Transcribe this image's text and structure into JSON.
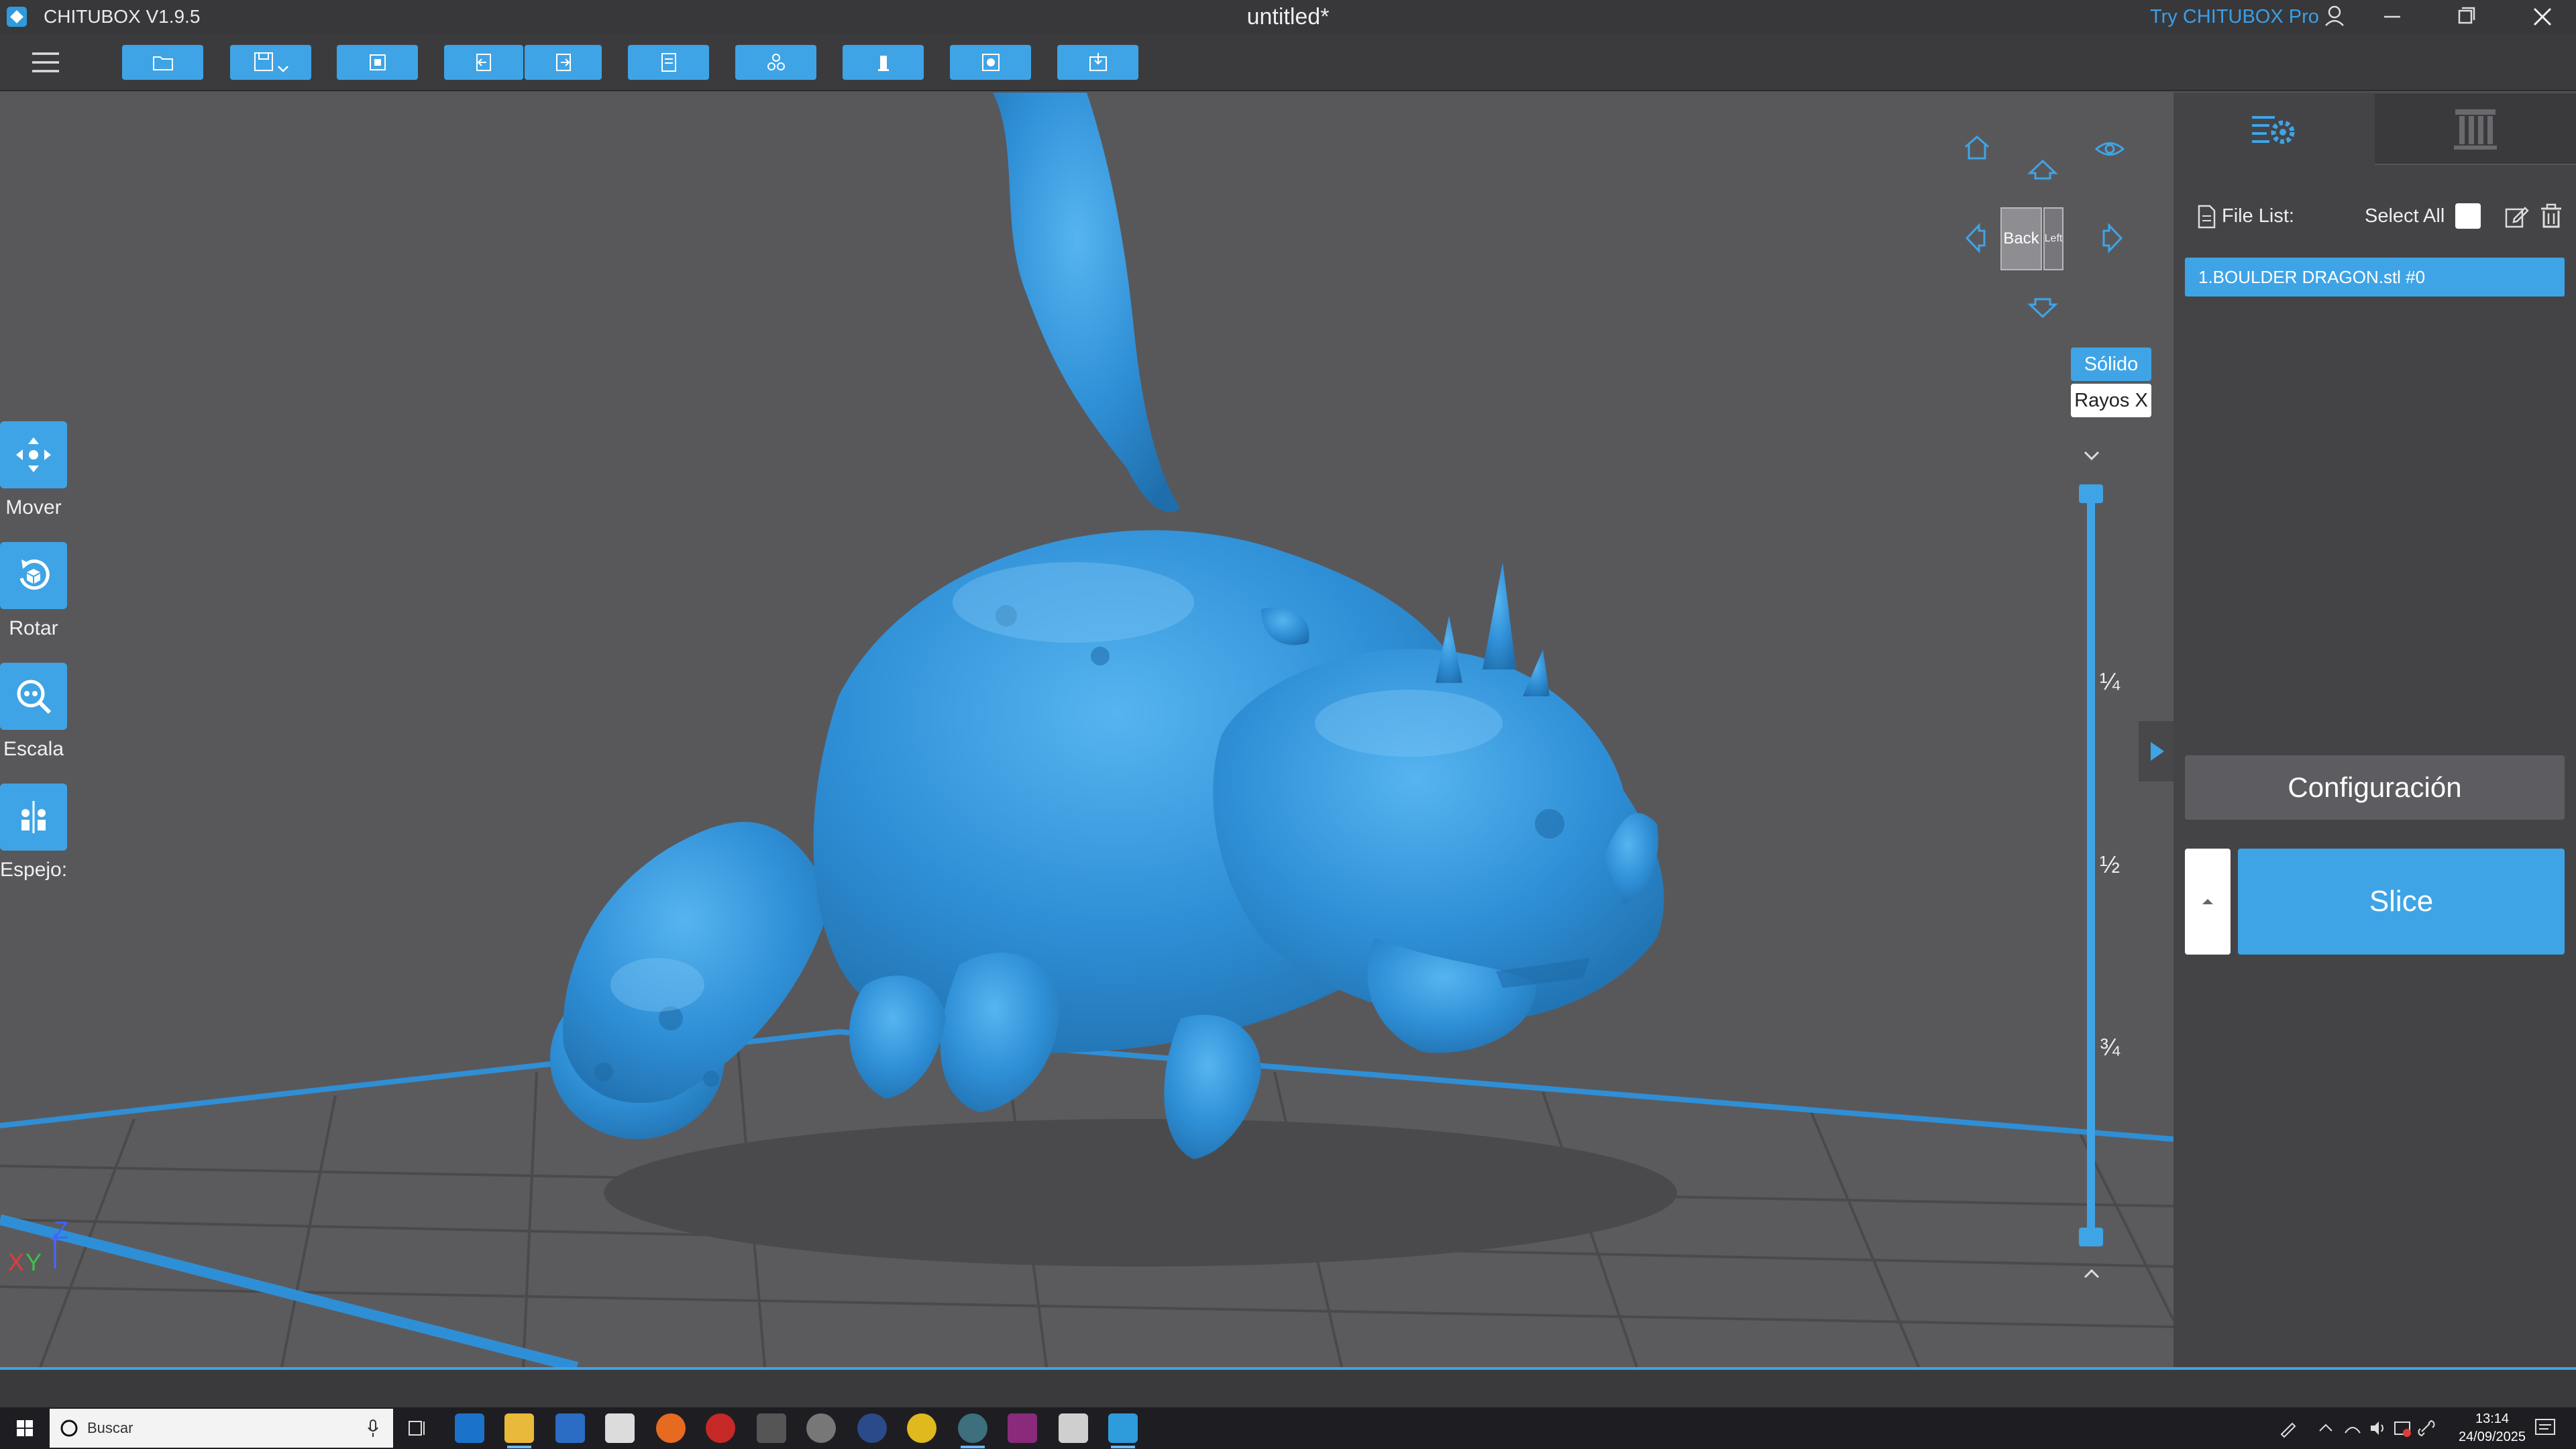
{
  "window": {
    "app_name": "CHITUBOX V1.9.5",
    "doc_title": "untitled*",
    "pro_link": "Try CHITUBOX Pro"
  },
  "toolbar": {
    "buttons": [
      "open-file",
      "save",
      "select-frame",
      "undo",
      "redo",
      "layout",
      "arrange",
      "supports",
      "hollow",
      "dig-hole"
    ]
  },
  "side_tools": {
    "move": "Mover",
    "rotate": "Rotar",
    "scale": "Escala",
    "mirror": "Espejo:"
  },
  "nav_cube": {
    "face": "Back",
    "side": "Left"
  },
  "render_modes": {
    "solid": "Sólido",
    "xray": "Rayos X"
  },
  "layer_slider": {
    "marks": [
      "¼",
      "½",
      "¾"
    ]
  },
  "axis": {
    "z": "Z",
    "x": "X",
    "y": "Y"
  },
  "panel": {
    "file_list_label": "File List:",
    "select_all_label": "Select All",
    "files": [
      "1.BOULDER DRAGON.stl #0"
    ],
    "config_label": "Configuración",
    "slice_label": "Slice"
  },
  "taskbar": {
    "search_placeholder": "Buscar",
    "time": "13:14",
    "date": "24/09/2025"
  },
  "colors": {
    "accent": "#3fa4e6",
    "model": "#2f8fd6",
    "background": "#58585b",
    "panel": "#444447"
  }
}
